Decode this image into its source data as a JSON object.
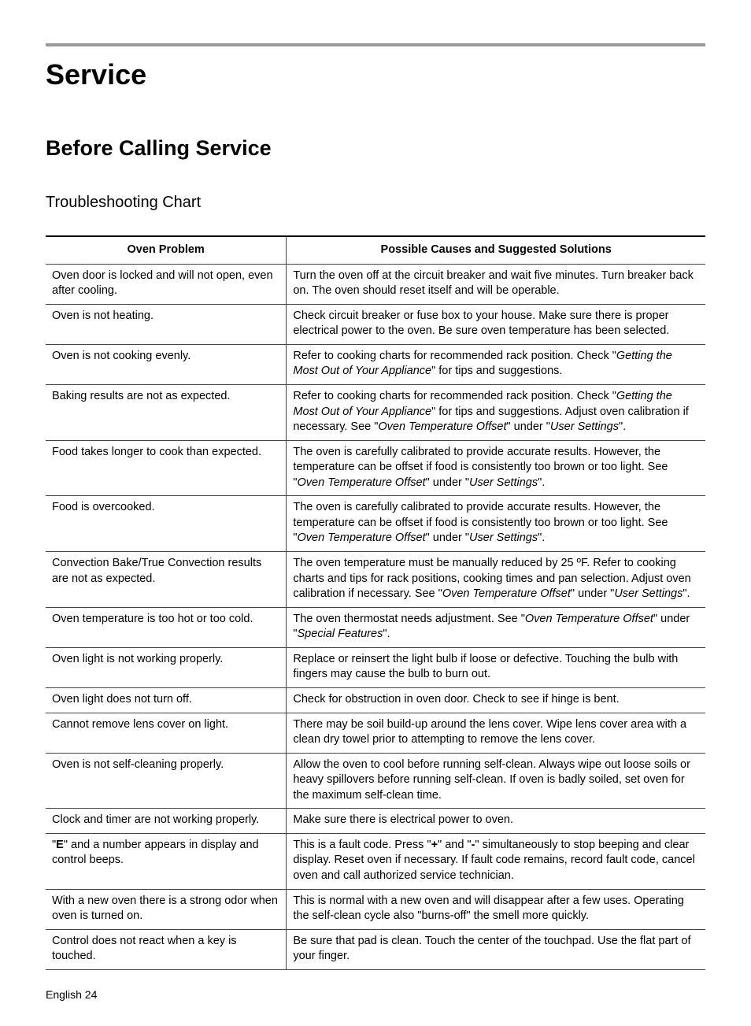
{
  "h1": "Service",
  "h2": "Before Calling Service",
  "h3": "Troubleshooting Chart",
  "headers": {
    "col1": "Oven Problem",
    "col2": "Possible Causes and Suggested Solutions"
  },
  "rows": [
    {
      "problem": "Oven door is locked and will not open, even after cooling.",
      "solution": "Turn the oven off at the circuit breaker and wait five minutes. Turn breaker back on. The oven should reset itself and will be operable."
    },
    {
      "problem": "Oven is not heating.",
      "solution": "Check circuit breaker or fuse box to your house. Make sure there is proper electrical power to the oven. Be sure oven temperature has been selected."
    },
    {
      "problem": "Oven is not cooking evenly.",
      "solution_html": "Refer to cooking charts for recommended rack position. Check \"<span class=\"italic\">Getting the Most Out of Your Appliance</span>\" for tips and suggestions."
    },
    {
      "problem": "Baking results are not as expected.",
      "solution_html": "Refer to cooking charts for recommended rack position. Check \"<span class=\"italic\">Getting the Most Out of Your Appliance</span>\" for tips and suggestions. Adjust oven calibration if necessary. See \"<span class=\"italic\">Oven Temperature Offset</span>\" under \"<span class=\"italic\">User Settings</span>\"."
    },
    {
      "problem": "Food takes longer to cook than expected.",
      "solution_html": "The oven is carefully calibrated to provide accurate results. However, the temperature can be offset if food is consistently too brown or too light. See \"<span class=\"italic\">Oven Temperature Offset</span>\" under \"<span class=\"italic\">User Settings</span>\"."
    },
    {
      "problem": "Food is overcooked.",
      "solution_html": "The oven is carefully calibrated to provide accurate results. However, the temperature can be offset if food is consistently too brown or too light. See \"<span class=\"italic\">Oven Temperature Offset</span>\" under \"<span class=\"italic\">User Settings</span>\"."
    },
    {
      "problem": "Convection Bake/True Convection results are not as expected.",
      "solution_html": "The oven temperature must be manually reduced by 25 ºF. Refer to cooking charts and tips for rack positions, cooking times and pan selection. Adjust oven calibration if necessary. See \"<span class=\"italic\">Oven Temperature Offset</span>\" under \"<span class=\"italic\">User Settings</span>\"."
    },
    {
      "problem": "Oven temperature is too hot or too cold.",
      "solution_html": "The oven thermostat needs adjustment. See \"<span class=\"italic\">Oven Temperature Offset</span>\" under \"<span class=\"italic\">Special Features</span>\"."
    },
    {
      "problem": "Oven light is not working properly.",
      "solution": "Replace or reinsert the light bulb if loose or defective. Touching the bulb with fingers may cause the bulb to burn out."
    },
    {
      "problem": "Oven light does not turn off.",
      "solution": "Check for obstruction in oven door. Check to see if hinge is bent."
    },
    {
      "problem": "Cannot remove lens cover on light.",
      "solution": "There may be soil build-up around the lens cover. Wipe lens cover area with a clean dry towel prior to attempting to remove the lens cover."
    },
    {
      "problem": "Oven is not self-cleaning properly.",
      "solution": "Allow the oven to cool before running self-clean. Always wipe out loose soils or heavy spillovers before running self-clean. If oven is badly soiled, set oven for the maximum self-clean time."
    },
    {
      "problem": "Clock and timer are not working properly.",
      "solution": "Make sure there is electrical power to oven."
    },
    {
      "problem_html": "\"<span class=\"bold\">E</span>\" and a number appears in display and control beeps.",
      "solution_html": "This is a fault code. Press \"<span class=\"bold\">+</span>\" and \"<span class=\"bold\">-</span>\" simultaneously to stop beeping and clear display. Reset oven if necessary. If fault code remains, record fault code, cancel oven and call authorized service technician."
    },
    {
      "problem": "With a new oven there is a strong odor when oven is turned on.",
      "solution": "This is normal with a new oven and will disappear after a few uses. Operating the self-clean cycle also \"burns-off\" the smell more quickly."
    },
    {
      "problem": "Control does not react when a key is touched.",
      "solution": "Be sure that pad is clean. Touch the center of the touchpad. Use the flat part of your finger."
    }
  ],
  "footer": "English 24"
}
